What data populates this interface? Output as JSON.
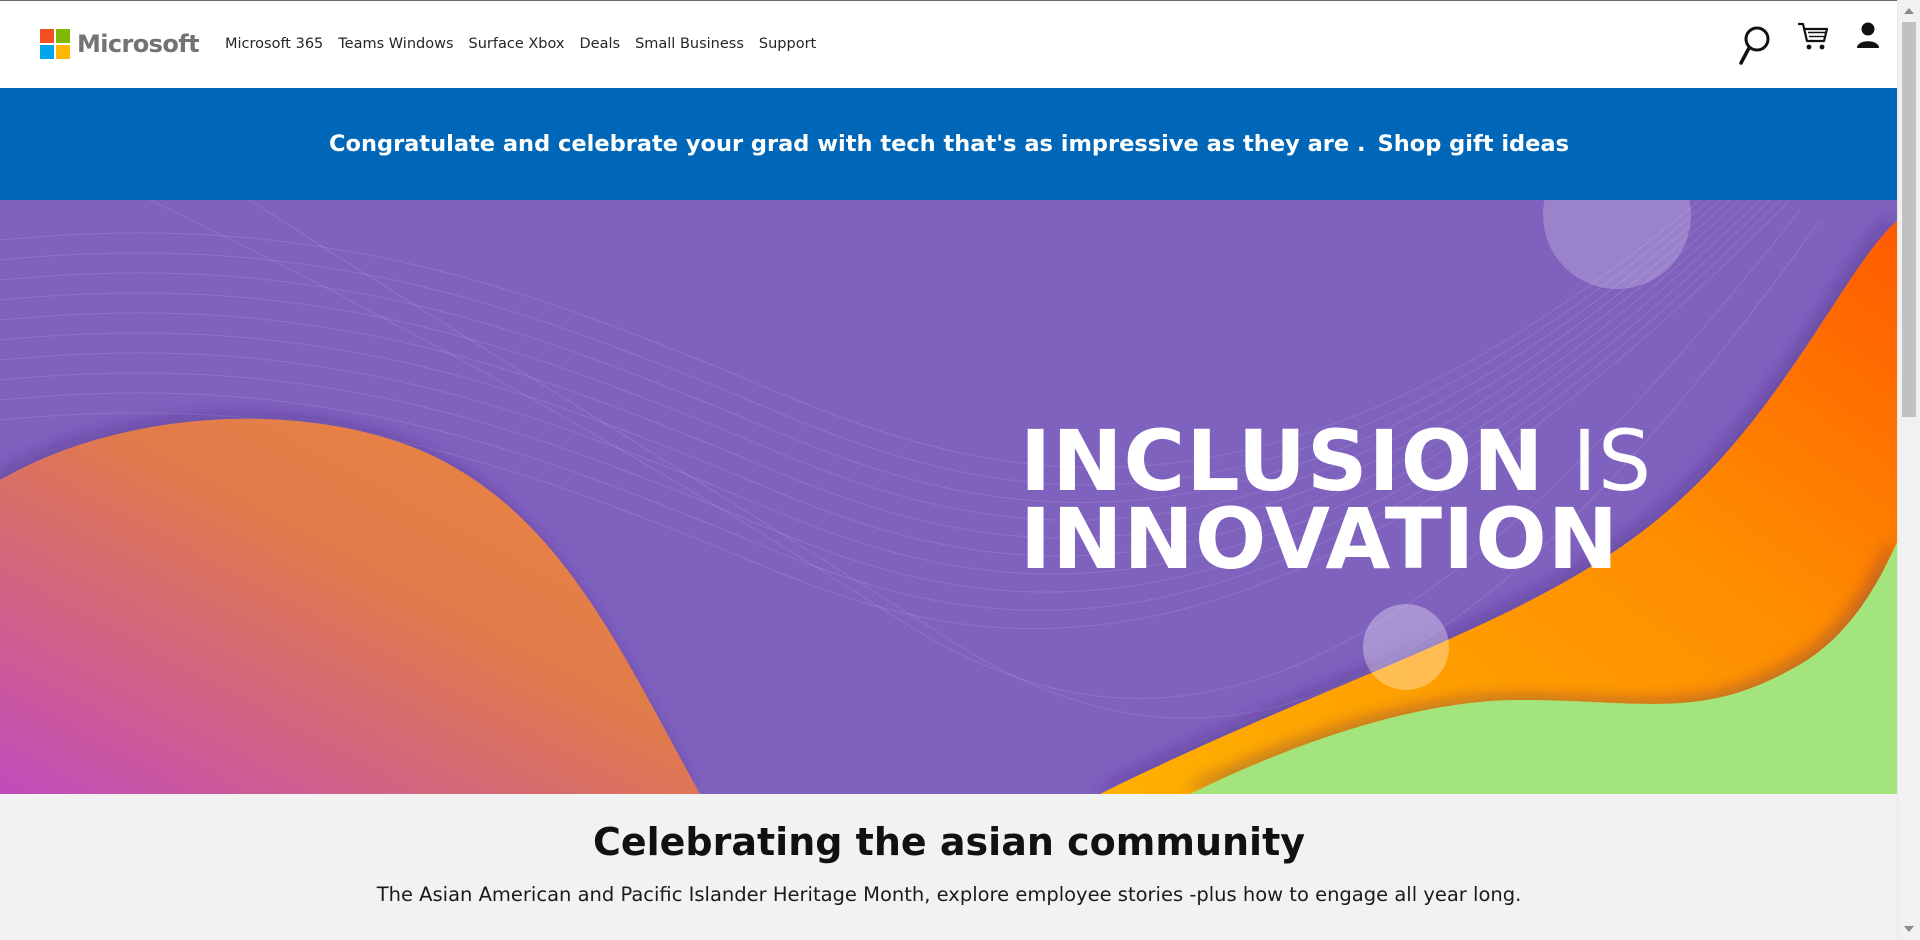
{
  "header": {
    "brand": "Microsoft",
    "nav": [
      "Microsoft 365",
      "Teams Windows",
      "Surface Xbox",
      "Deals",
      "Small Business",
      "Support"
    ],
    "icons": [
      "search-icon",
      "cart-icon",
      "account-icon"
    ]
  },
  "promo": {
    "text": "Congratulate and celebrate your grad with tech that's as impressive as they are .",
    "link": "Shop gift  ideas"
  },
  "hero": {
    "line1_bold": "INCLUSION",
    "line1_light": " IS",
    "line2": "INNOVATION"
  },
  "section": {
    "title": "Celebrating the asian community",
    "description": "The Asian American and Pacific Islander Heritage Month, explore employee stories -plus how to engage all year long."
  },
  "colors": {
    "promo_bg": "#0067b8",
    "hero_purple": "#7f61be",
    "logo_red": "#f25022",
    "logo_green": "#7fba00",
    "logo_blue": "#00a4ef",
    "logo_yellow": "#ffb900"
  }
}
